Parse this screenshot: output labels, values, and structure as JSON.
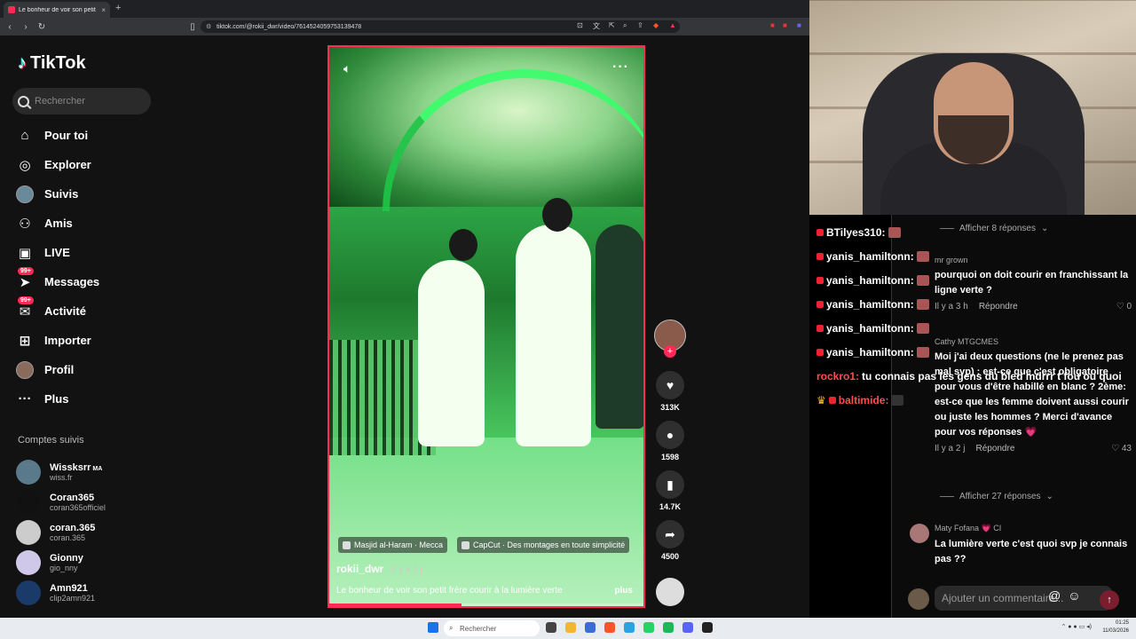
{
  "browser": {
    "tab_title": "Le bonheur de voir son petit",
    "tab_close": "×",
    "new_tab": "+",
    "url": "tiktok.com/@rokii_dwr/video/7614524059753139478"
  },
  "sidebar": {
    "logo": "TikTok",
    "search_placeholder": "Rechercher",
    "items": [
      {
        "label": "Pour toi",
        "icon": "home-icon"
      },
      {
        "label": "Explorer",
        "icon": "compass-icon"
      },
      {
        "label": "Suivis",
        "icon": "avatar-icon"
      },
      {
        "label": "Amis",
        "icon": "friends-icon"
      },
      {
        "label": "LIVE",
        "icon": "live-icon"
      },
      {
        "label": "Messages",
        "icon": "messages-icon",
        "badge": "99+"
      },
      {
        "label": "Activité",
        "icon": "activity-icon",
        "badge": "99+"
      },
      {
        "label": "Importer",
        "icon": "upload-icon"
      },
      {
        "label": "Profil",
        "icon": "profile-icon"
      },
      {
        "label": "Plus",
        "icon": "more-icon"
      }
    ],
    "following_title": "Comptes suivis",
    "following": [
      {
        "name": "Wissksrr",
        "tag": "MA",
        "handle": "wiss.fr"
      },
      {
        "name": "Coran365",
        "tag": "",
        "handle": "coran365officiel"
      },
      {
        "name": "coran.365",
        "tag": "",
        "handle": "coran.365"
      },
      {
        "name": "Gionny",
        "tag": "",
        "handle": "gio_nny"
      },
      {
        "name": "Amn921",
        "tag": "",
        "handle": "clip2amn921"
      }
    ]
  },
  "video": {
    "location_chip": "Masjid al-Haram · Mecca",
    "capcut_chip": "CapCut · Des montages en toute simplicité",
    "username": "rokii_dwr",
    "posted": " · Il y a 3 j",
    "description": "Le bonheur de voir son petit frère courir à la lumière verte",
    "more": "plus",
    "progress": 0.42
  },
  "actions": {
    "likes": "313K",
    "comments": "1598",
    "saves": "14.7K",
    "shares": "4500"
  },
  "chat": [
    {
      "user": "BTilyes310:",
      "message": "",
      "color": "#ffffff"
    },
    {
      "user": "yanis_hamiltonn:",
      "message": "",
      "color": "#ffffff"
    },
    {
      "user": "yanis_hamiltonn:",
      "message": "",
      "color": "#ffffff"
    },
    {
      "user": "yanis_hamiltonn:",
      "message": "",
      "color": "#ffffff"
    },
    {
      "user": "yanis_hamiltonn:",
      "message": "",
      "color": "#ffffff"
    },
    {
      "user": "yanis_hamiltonn:",
      "message": "",
      "color": "#ffffff"
    },
    {
      "user": "rockro1:",
      "message": "tu connais pas les gens du bled mdrrr t fou ou quoi",
      "color": "#ff4d4d"
    },
    {
      "user": "baltimide:",
      "message": "",
      "color": "#ff4d4d"
    }
  ],
  "comments": {
    "replies_top": "Afficher 8 réponses",
    "c1": {
      "user": "mr grown",
      "text": "pourquoi on doit courir en franchissant la ligne verte ?",
      "time": "Il y a 3 h",
      "reply": "Répondre",
      "likes": "0"
    },
    "c2": {
      "user": "Cathy MTGCMES",
      "text": "Moi j'ai deux questions (ne le prenez pas mal svp) : est-ce que c'est obligatoire pour vous d'être habillé en blanc ? 2ème: est-ce que les femme doivent aussi courir ou juste les hommes ? Merci d'avance pour vos réponses 💗",
      "time": "Il y a 2 j",
      "reply": "Répondre",
      "likes": "43"
    },
    "replies_mid": "Afficher 27 réponses",
    "c3": {
      "user": "Maty Fofana 💗 CI",
      "text": "La lumière verte c'est quoi svp je connais pas ??"
    },
    "add_placeholder": "Ajouter un commentaire..."
  },
  "taskbar": {
    "search": "Rechercher",
    "time": "01:25",
    "date": "11/03/2026"
  }
}
